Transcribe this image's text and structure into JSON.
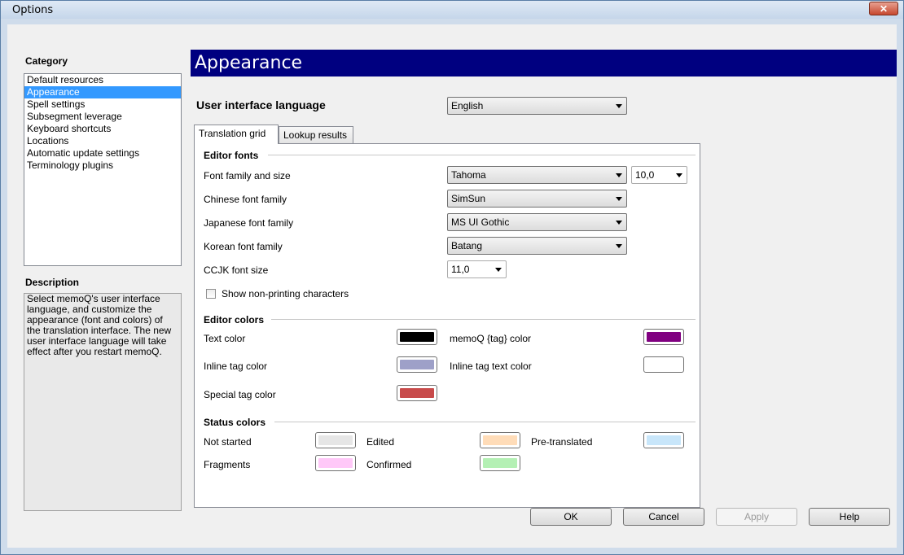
{
  "window": {
    "title": "Options",
    "close_glyph": "✕"
  },
  "category": {
    "header": "Category",
    "items": [
      "Default resources",
      "Appearance",
      "Spell settings",
      "Subsegment leverage",
      "Keyboard shortcuts",
      "Locations",
      "Automatic update settings",
      "Terminology plugins"
    ],
    "selected": "Appearance"
  },
  "description": {
    "header": "Description",
    "text": "Select memoQ's user interface language, and customize the appearance (font and colors) of the translation interface. The new user interface language will take effect after you restart memoQ."
  },
  "banner": {
    "title": "Appearance"
  },
  "ui_language": {
    "label": "User interface language",
    "value": "English"
  },
  "tabs": [
    "Translation grid",
    "Lookup results"
  ],
  "editor_fonts": {
    "header": "Editor fonts",
    "font_family_label": "Font family and size",
    "font_family_value": "Tahoma",
    "font_size_value": "10,0",
    "chinese_label": "Chinese font family",
    "chinese_value": "SimSun",
    "japanese_label": "Japanese font family",
    "japanese_value": "MS UI Gothic",
    "korean_label": "Korean font family",
    "korean_value": "Batang",
    "ccjk_label": "CCJK font size",
    "ccjk_value": "11,0",
    "show_nonprinting_label": "Show non-printing characters",
    "show_nonprinting_checked": false
  },
  "editor_colors": {
    "header": "Editor colors",
    "text_color_label": "Text color",
    "text_color": "#000000",
    "memoq_tag_label": "memoQ {tag} color",
    "memoq_tag_color": "#800080",
    "inline_tag_label": "Inline tag color",
    "inline_tag_color": "#9ea0c8",
    "inline_tag_text_label": "Inline tag text color",
    "inline_tag_text_color": "#ffffff",
    "special_tag_label": "Special tag color",
    "special_tag_color": "#c84b4b"
  },
  "status_colors": {
    "header": "Status colors",
    "not_started_label": "Not started",
    "not_started_color": "#e6e6e6",
    "edited_label": "Edited",
    "edited_color": "#ffdcb8",
    "pretranslated_label": "Pre-translated",
    "pretranslated_color": "#c8e6fa",
    "fragments_label": "Fragments",
    "fragments_color": "#ffc8f8",
    "confirmed_label": "Confirmed",
    "confirmed_color": "#b4f0b4"
  },
  "buttons": {
    "ok": "OK",
    "cancel": "Cancel",
    "apply": "Apply",
    "help": "Help"
  }
}
